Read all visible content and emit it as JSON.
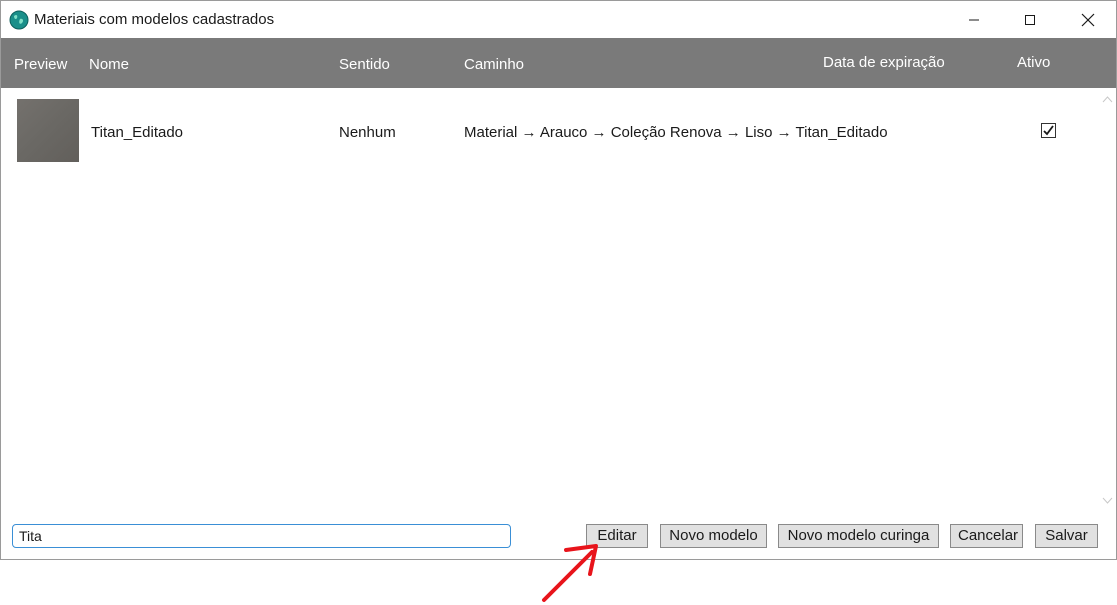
{
  "window": {
    "title": "Materiais com modelos cadastrados",
    "icon": "globe-icon"
  },
  "table": {
    "headers": {
      "preview": "Preview",
      "nome": "Nome",
      "sentido": "Sentido",
      "caminho": "Caminho",
      "data_expiracao": "Data de expiração",
      "ativo": "Ativo"
    },
    "rows": [
      {
        "nome": "Titan_Editado",
        "sentido": "Nenhum",
        "caminho": "Material → Arauco → Coleção Renova → Liso → Titan_Editado",
        "data_expiracao": "",
        "ativo": true
      }
    ]
  },
  "search": {
    "value": "Tita"
  },
  "buttons": {
    "editar": "Editar",
    "novo_modelo": "Novo modelo",
    "novo_modelo_curinga": "Novo modelo curinga",
    "cancelar": "Cancelar",
    "salvar": "Salvar"
  },
  "colors": {
    "header_bg": "#7a7a7a",
    "annotation_arrow": "#e8141b",
    "search_border": "#3a8fd6"
  }
}
